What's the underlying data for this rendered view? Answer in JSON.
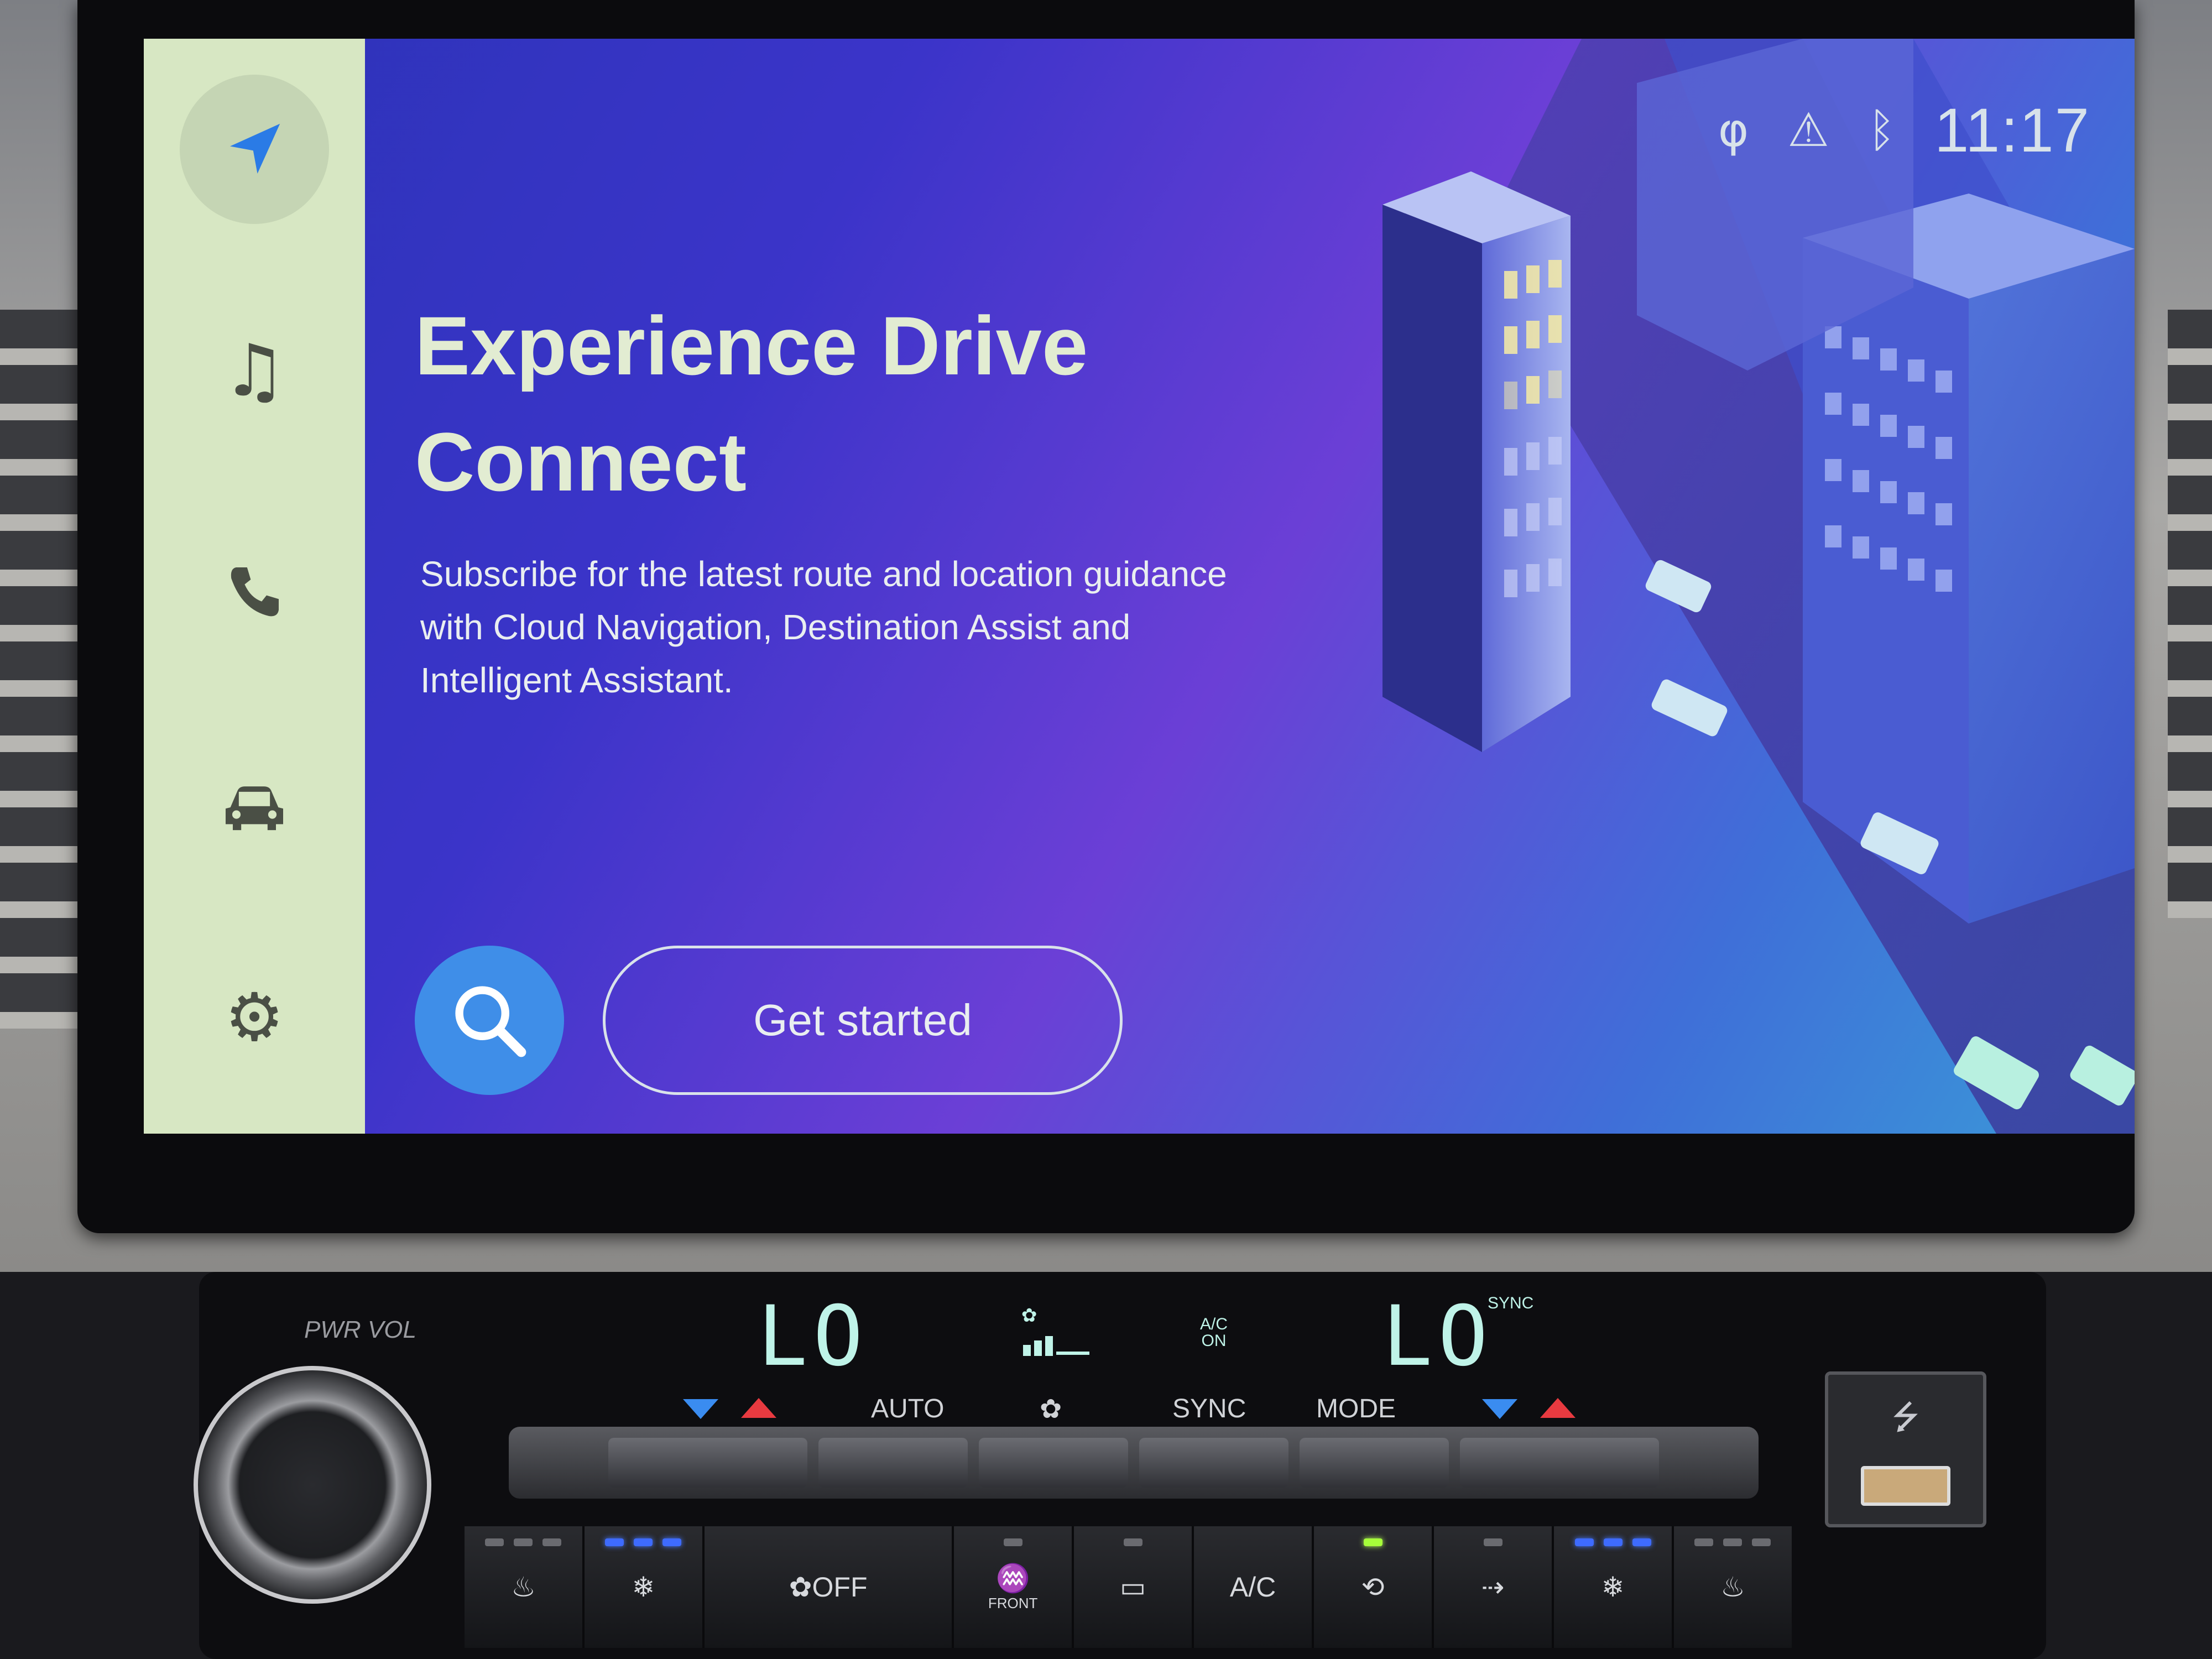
{
  "screen": {
    "title_line1": "Experience Drive",
    "title_line2": "Connect",
    "description": "Subscribe for the latest route and location guidance with Cloud Navigation, Destination Assist and Intelligent Assistant.",
    "get_started_label": "Get started",
    "status_bar": {
      "clock": "11:17"
    },
    "sidebar": {
      "items": [
        {
          "icon": "navigation-icon",
          "active": true
        },
        {
          "icon": "music-icon"
        },
        {
          "icon": "phone-icon"
        },
        {
          "icon": "car-icon"
        },
        {
          "icon": "gear-icon"
        }
      ]
    }
  },
  "climate": {
    "knob_label": "PWR VOL",
    "left_temp": "LO",
    "right_temp": "LO",
    "sync_indicator": "SYNC",
    "ac_on_line1": "A/C",
    "ac_on_line2": "ON",
    "rocker_labels": {
      "auto": "AUTO",
      "sync": "SYNC",
      "mode": "MODE"
    },
    "buttons": {
      "fan_off": "OFF",
      "front_defrost": "FRONT",
      "ac": "A/C"
    }
  },
  "colors": {
    "sidebar_bg": "#d7e7c3",
    "title_text": "#e2ecd2",
    "search_button": "#3f8ee8",
    "lcd_text": "#bff3e8"
  }
}
